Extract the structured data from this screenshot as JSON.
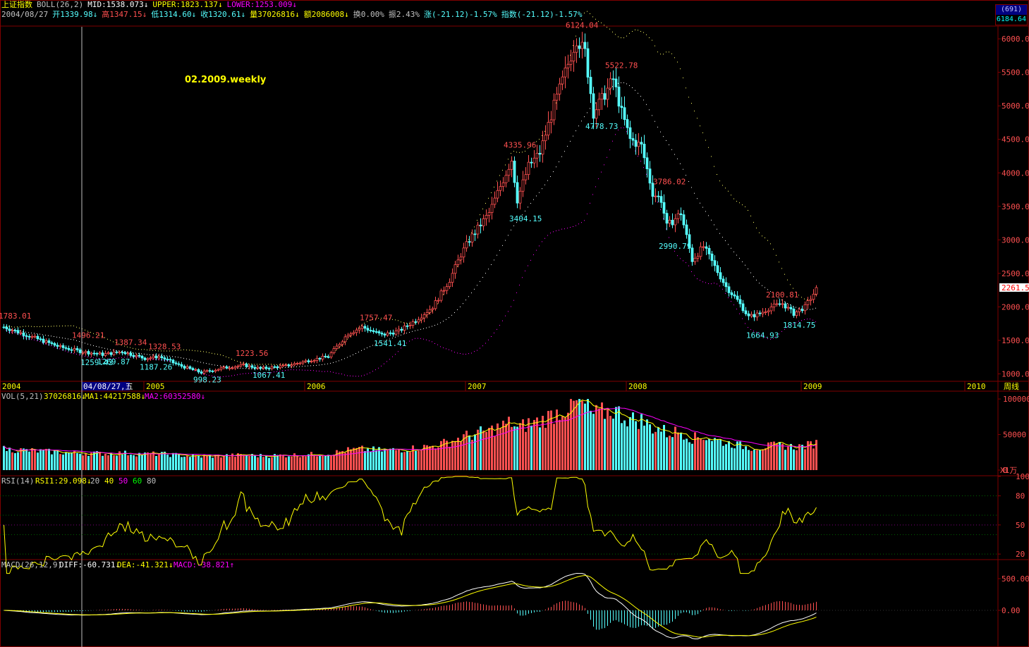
{
  "header": {
    "index_name": "上证指数",
    "boll_label": "BOLL(26,2)",
    "mid": "MID:1538.073↓",
    "upper": "UPPER:1823.137↓",
    "lower": "LOWER:1253.009↓",
    "row2": {
      "date": "2004/08/27",
      "open": "开1339.98↓",
      "high": "高1347.15↓",
      "low": "低1314.60↓",
      "close": "收1320.61↓",
      "volume": "量37026816↓",
      "amount": "额2086008↓",
      "turnover": "换0.00%",
      "amplitude": "振2.43%",
      "change": "涨(-21.12)-1.57%",
      "index_change": "指数(-21.12)-1.57%"
    },
    "code_box": "(691)",
    "top_price": "6184.64"
  },
  "watermark": "02.2009.weekly",
  "colors": {
    "up": "#ff5050",
    "down": "#55ffff",
    "frame": "#800000",
    "upper": "#ffff66",
    "mid": "#ffffff",
    "lower": "#ff00ff",
    "ma1": "#ffff00",
    "ma2": "#ff00ff"
  },
  "price_axis": {
    "ticks": [
      "6000.0",
      "5500.0",
      "5000.0",
      "4500.0",
      "4000.0",
      "3500.0",
      "3000.0",
      "2500.0",
      "2000.0",
      "1500.0",
      "1000.0"
    ],
    "current": "2261.5",
    "ymin": 900,
    "ymax": 6180
  },
  "price_annotations": [
    {
      "text": "1783.01",
      "value": 1783.01,
      "week": 1,
      "kind": "high"
    },
    {
      "text": "1496.21",
      "value": 1496.21,
      "week": 27,
      "kind": "high"
    },
    {
      "text": "1259.43",
      "value": 1259.43,
      "week": 30,
      "kind": "low"
    },
    {
      "text": "1387.34",
      "value": 1387.34,
      "week": 42,
      "kind": "high"
    },
    {
      "text": "1269.87",
      "value": 1269.87,
      "week": 36,
      "kind": "low"
    },
    {
      "text": "1328.53",
      "value": 1328.53,
      "week": 54,
      "kind": "high"
    },
    {
      "text": "1187.26",
      "value": 1187.26,
      "week": 51,
      "kind": "low"
    },
    {
      "text": "998.23",
      "value": 998.23,
      "week": 70,
      "kind": "low"
    },
    {
      "text": "1223.56",
      "value": 1223.56,
      "week": 85,
      "kind": "high"
    },
    {
      "text": "1067.41",
      "value": 1067.41,
      "week": 91,
      "kind": "low"
    },
    {
      "text": "1757.47",
      "value": 1757.47,
      "week": 129,
      "kind": "high"
    },
    {
      "text": "1541.41",
      "value": 1541.41,
      "week": 134,
      "kind": "low"
    },
    {
      "text": "4335.96",
      "value": 4335.96,
      "week": 180,
      "kind": "high"
    },
    {
      "text": "3404.15",
      "value": 3404.15,
      "week": 182,
      "kind": "low"
    },
    {
      "text": "6124.04",
      "value": 6124.04,
      "week": 202,
      "kind": "high"
    },
    {
      "text": "4778.73",
      "value": 4778.73,
      "week": 209,
      "kind": "low"
    },
    {
      "text": "5522.78",
      "value": 5522.78,
      "week": 216,
      "kind": "high"
    },
    {
      "text": "3786.02",
      "value": 3786.02,
      "week": 233,
      "kind": "high"
    },
    {
      "text": "2990.79",
      "value": 2990.79,
      "week": 235,
      "kind": "low"
    },
    {
      "text": "1664.93",
      "value": 1664.93,
      "week": 266,
      "kind": "low"
    },
    {
      "text": "2100.81",
      "value": 2100.81,
      "week": 273,
      "kind": "high"
    },
    {
      "text": "1814.75",
      "value": 1814.75,
      "week": 279,
      "kind": "low"
    }
  ],
  "time_axis": {
    "labels": [
      {
        "text": "2004",
        "week": -1
      },
      {
        "text": "2005",
        "week": 50
      },
      {
        "text": "2006",
        "week": 107
      },
      {
        "text": "2007",
        "week": 164
      },
      {
        "text": "2008",
        "week": 221
      },
      {
        "text": "2009",
        "week": 283
      },
      {
        "text": "2010",
        "week": 341
      }
    ],
    "cursor_label": "04/08/27,五",
    "cursor_week": 28,
    "period": "周线"
  },
  "price_keys": [
    [
      0,
      1700
    ],
    [
      10,
      1550
    ],
    [
      20,
      1400
    ],
    [
      28,
      1330
    ],
    [
      35,
      1290
    ],
    [
      42,
      1330
    ],
    [
      50,
      1230
    ],
    [
      55,
      1260
    ],
    [
      62,
      1130
    ],
    [
      70,
      1020
    ],
    [
      78,
      1090
    ],
    [
      85,
      1130
    ],
    [
      91,
      1080
    ],
    [
      100,
      1120
    ],
    [
      108,
      1200
    ],
    [
      115,
      1260
    ],
    [
      122,
      1600
    ],
    [
      127,
      1700
    ],
    [
      134,
      1580
    ],
    [
      140,
      1640
    ],
    [
      146,
      1800
    ],
    [
      152,
      2000
    ],
    [
      158,
      2400
    ],
    [
      162,
      2780
    ],
    [
      165,
      3000
    ],
    [
      172,
      3400
    ],
    [
      176,
      3800
    ],
    [
      180,
      4200
    ],
    [
      182,
      3600
    ],
    [
      186,
      4100
    ],
    [
      190,
      4300
    ],
    [
      195,
      5000
    ],
    [
      199,
      5500
    ],
    [
      203,
      6000
    ],
    [
      206,
      5800
    ],
    [
      209,
      4900
    ],
    [
      212,
      5100
    ],
    [
      216,
      5400
    ],
    [
      219,
      4900
    ],
    [
      222,
      4500
    ],
    [
      226,
      4400
    ],
    [
      230,
      3700
    ],
    [
      233,
      3600
    ],
    [
      235,
      3200
    ],
    [
      240,
      3400
    ],
    [
      244,
      2700
    ],
    [
      248,
      2900
    ],
    [
      252,
      2600
    ],
    [
      256,
      2300
    ],
    [
      260,
      2100
    ],
    [
      264,
      1850
    ],
    [
      268,
      1900
    ],
    [
      272,
      2000
    ],
    [
      276,
      2050
    ],
    [
      280,
      1900
    ],
    [
      284,
      2000
    ],
    [
      288,
      2261
    ]
  ],
  "volume_panel": {
    "label": "VOL(5,21)",
    "value": "37026816↓",
    "ma1": "MA1:44217588↓",
    "ma2": "MA2:60352580↓",
    "ticks": [
      "100000",
      "50000",
      "0"
    ],
    "unit": "X1万",
    "vmax": 110000
  },
  "rsi_panel": {
    "label": "RSI(14)",
    "rsi1": "RSI1:29.098↓",
    "levels": [
      "20",
      "40",
      "50",
      "60",
      "80"
    ],
    "ticks": [
      "100",
      "80",
      "50",
      "20"
    ]
  },
  "macd_panel": {
    "label": "MACD(26,12,9)",
    "diff": "DIFF:-60.731↓",
    "dea": "DEA:-41.321↓",
    "macd": "MACD:-38.821↑",
    "ticks": [
      "500.00",
      "0.00"
    ]
  }
}
